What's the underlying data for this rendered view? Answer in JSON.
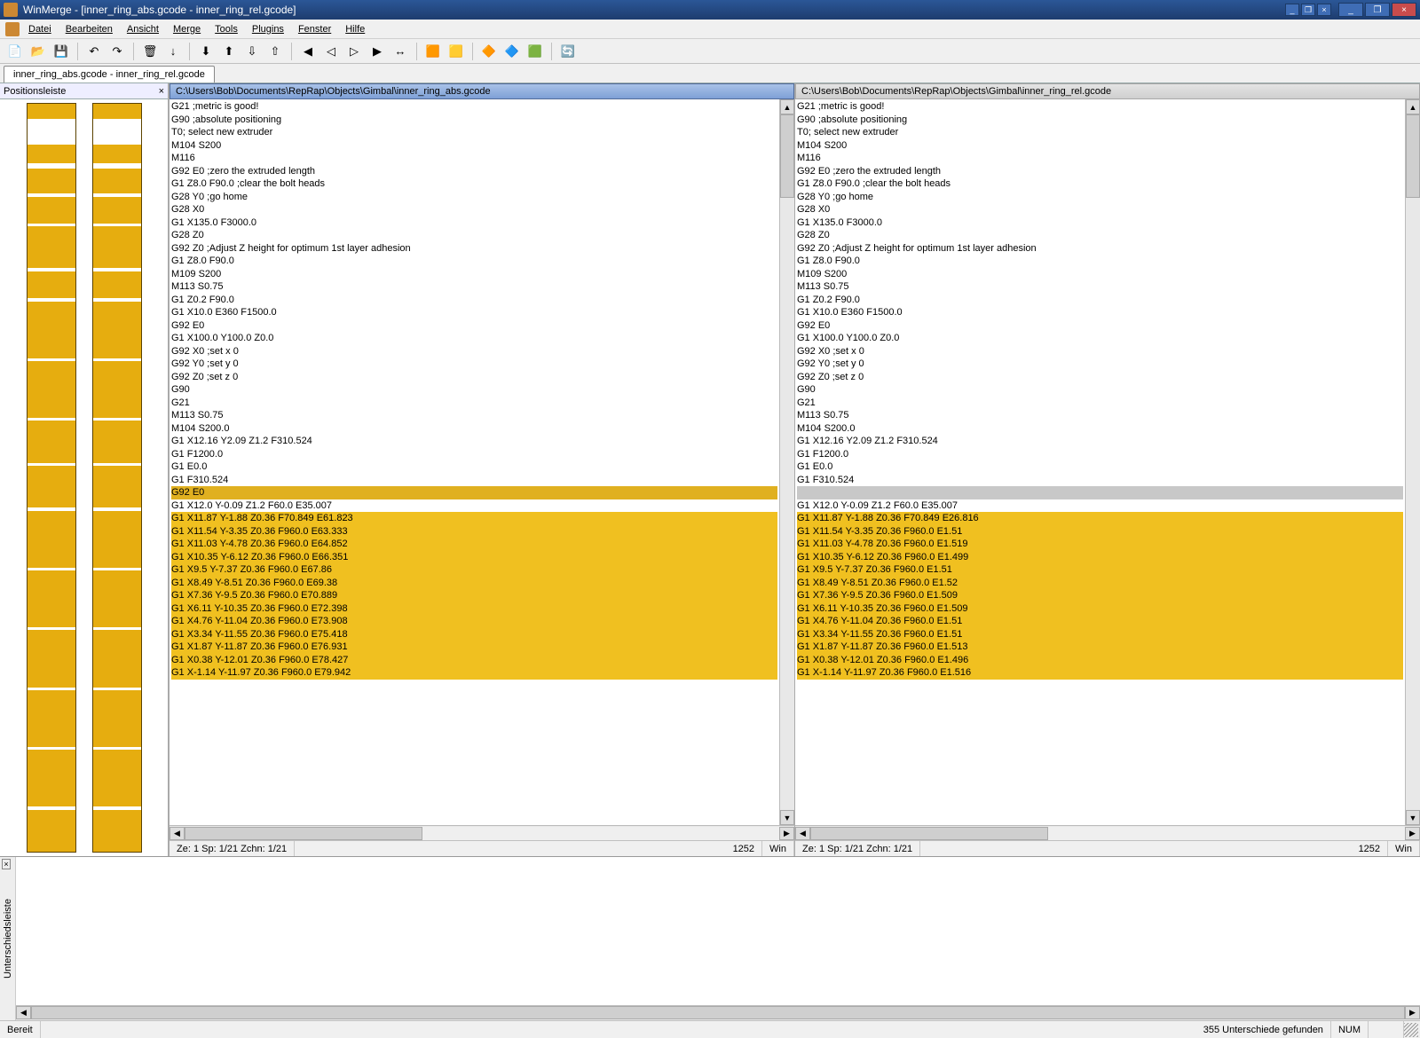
{
  "window": {
    "title": "WinMerge - [inner_ring_abs.gcode - inner_ring_rel.gcode]"
  },
  "menu": {
    "items": [
      "Datei",
      "Bearbeiten",
      "Ansicht",
      "Merge",
      "Tools",
      "Plugins",
      "Fenster",
      "Hilfe"
    ]
  },
  "tab": {
    "label": "inner_ring_abs.gcode - inner_ring_rel.gcode"
  },
  "location_panel": {
    "title": "Positionsleiste",
    "close": "×"
  },
  "common_lines": [
    "G21 ;metric is good!",
    "G90 ;absolute positioning",
    "T0; select new extruder",
    "M104 S200",
    "M116",
    "G92 E0 ;zero the extruded length",
    "G1 Z8.0 F90.0 ;clear the bolt heads",
    "G28 Y0 ;go home",
    "G28 X0",
    "G1 X135.0 F3000.0",
    "G28 Z0",
    "G92 Z0 ;Adjust Z height for optimum 1st layer adhesion",
    "G1 Z8.0 F90.0",
    "M109 S200",
    "M113 S0.75",
    "G1 Z0.2 F90.0",
    "G1 X10.0 E360 F1500.0",
    "G92 E0",
    "G1 X100.0 Y100.0 Z0.0",
    "G92 X0 ;set x 0",
    "G92 Y0 ;set y 0",
    "G92 Z0 ;set z 0",
    "G90",
    "G21",
    "M113 S0.75",
    "M104 S200.0",
    "G1 X12.16 Y2.09 Z1.2 F310.524",
    "G1 F1200.0",
    "G1 E0.0",
    "G1 F310.524"
  ],
  "left": {
    "path": "C:\\Users\\Bob\\Documents\\RepRap\\Objects\\Gimbal\\inner_ring_abs.gcode",
    "sel_line": "G92 E0",
    "after_sel": "G1 X12.0 Y-0.09 Z1.2 F60.0 E35.007",
    "diff_lines": [
      "G1 X11.87 Y-1.88 Z0.36 F70.849 E61.823",
      "G1 X11.54 Y-3.35 Z0.36 F960.0 E63.333",
      "G1 X11.03 Y-4.78 Z0.36 F960.0 E64.852",
      "G1 X10.35 Y-6.12 Z0.36 F960.0 E66.351",
      "G1 X9.5 Y-7.37 Z0.36 F960.0 E67.86",
      "G1 X8.49 Y-8.51 Z0.36 F960.0 E69.38",
      "G1 X7.36 Y-9.5 Z0.36 F960.0 E70.889",
      "G1 X6.11 Y-10.35 Z0.36 F960.0 E72.398",
      "G1 X4.76 Y-11.04 Z0.36 F960.0 E73.908",
      "G1 X3.34 Y-11.55 Z0.36 F960.0 E75.418",
      "G1 X1.87 Y-11.87 Z0.36 F960.0 E76.931",
      "G1 X0.38 Y-12.01 Z0.36 F960.0 E78.427",
      "G1 X-1.14 Y-11.97 Z0.36 F960.0 E79.942"
    ],
    "status": {
      "pos": "Ze: 1  Sp: 1/21  Zchn: 1/21",
      "cp": "1252",
      "eol": "Win"
    }
  },
  "right": {
    "path": "C:\\Users\\Bob\\Documents\\RepRap\\Objects\\Gimbal\\inner_ring_rel.gcode",
    "gap_line": "",
    "after_sel": "G1 X12.0 Y-0.09 Z1.2 F60.0 E35.007",
    "diff_lines": [
      "G1 X11.87 Y-1.88 Z0.36 F70.849 E26.816",
      "G1 X11.54 Y-3.35 Z0.36 F960.0 E1.51",
      "G1 X11.03 Y-4.78 Z0.36 F960.0 E1.519",
      "G1 X10.35 Y-6.12 Z0.36 F960.0 E1.499",
      "G1 X9.5 Y-7.37 Z0.36 F960.0 E1.51",
      "G1 X8.49 Y-8.51 Z0.36 F960.0 E1.52",
      "G1 X7.36 Y-9.5 Z0.36 F960.0 E1.509",
      "G1 X6.11 Y-10.35 Z0.36 F960.0 E1.509",
      "G1 X4.76 Y-11.04 Z0.36 F960.0 E1.51",
      "G1 X3.34 Y-11.55 Z0.36 F960.0 E1.51",
      "G1 X1.87 Y-11.87 Z0.36 F960.0 E1.513",
      "G1 X0.38 Y-12.01 Z0.36 F960.0 E1.496",
      "G1 X-1.14 Y-11.97 Z0.36 F960.0 E1.516"
    ],
    "status": {
      "pos": "Ze: 1  Sp: 1/21  Zchn: 1/21",
      "cp": "1252",
      "eol": "Win"
    }
  },
  "bottom_panel": {
    "label": "Unterschiedsleiste",
    "close": "×"
  },
  "statusbar": {
    "ready": "Bereit",
    "diffs": "355 Unterschiede gefunden",
    "num": "NUM"
  },
  "toolbar_icons": [
    "📄",
    "📂",
    "💾",
    "|",
    "↶",
    "↷",
    "|",
    "🗑",
    "↓",
    "|",
    "⬇",
    "⬆",
    "⇩",
    "⇧",
    "|",
    "◀",
    "◁",
    "▷",
    "▶",
    "↔",
    "|",
    "🟧",
    "🟨",
    "|",
    "🔶",
    "🔷",
    "🟩",
    "|",
    "🔄"
  ]
}
